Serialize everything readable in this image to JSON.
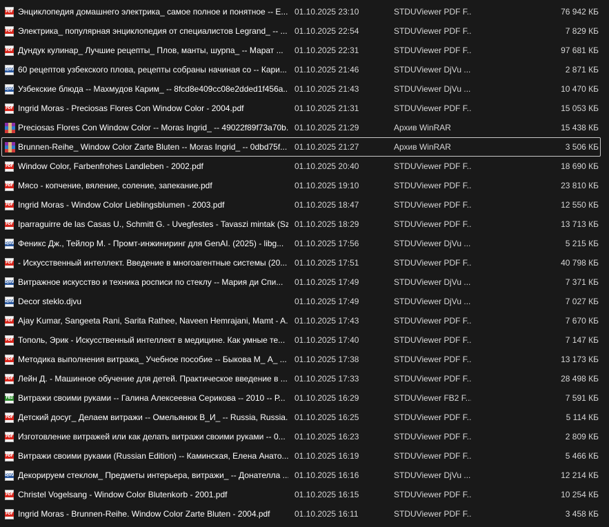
{
  "files": [
    {
      "name": "Энциклопедия домашнего электрика_ самое полное и понятное -- Е...",
      "date": "01.10.2025 23:10",
      "type": "STDUViewer PDF F...",
      "size": "76 942 КБ",
      "icon": "pdf-file-icon",
      "icon_label": "PDF"
    },
    {
      "name": "Электрика_ популярная энциклопедия от специалистов Legrand_ -- ...",
      "date": "01.10.2025 22:54",
      "type": "STDUViewer PDF F...",
      "size": "7 829 КБ",
      "icon": "pdf-file-icon",
      "icon_label": "PDF"
    },
    {
      "name": "Дундук кулинар_ Лучшие рецепты_ Плов, манты, шурпа_ -- Марат ...",
      "date": "01.10.2025 22:31",
      "type": "STDUViewer PDF F...",
      "size": "97 681 КБ",
      "icon": "pdf-file-icon",
      "icon_label": "PDF"
    },
    {
      "name": "60 рецептов узбекского плова, рецепты собраны начиная со -- Кари...",
      "date": "01.10.2025 21:46",
      "type": "STDUViewer DjVu ...",
      "size": "2 871 КБ",
      "icon": "djvu-file-icon",
      "icon_label": "DJVU"
    },
    {
      "name": "Узбекские блюда -- Махмудов Карим_ -- 8fcd8e409cc08e2dded1f456a...",
      "date": "01.10.2025 21:43",
      "type": "STDUViewer DjVu ...",
      "size": "10 470 КБ",
      "icon": "djvu-file-icon",
      "icon_label": "DJVU"
    },
    {
      "name": "Ingrid Moras - Preciosas Flores Con Window Color - 2004.pdf",
      "date": "01.10.2025 21:31",
      "type": "STDUViewer PDF F...",
      "size": "15 053 КБ",
      "icon": "pdf-file-icon",
      "icon_label": "PDF"
    },
    {
      "name": "Preciosas Flores Con Window Color -- Moras Ingrid_ -- 49022f89f73a70b...",
      "date": "01.10.2025 21:29",
      "type": "Архив WinRAR",
      "size": "15 438 КБ",
      "icon": "rar-archive-icon",
      "icon_label": ""
    },
    {
      "name": "Brunnen-Reihe_ Window Color Zarte Bluten -- Moras Ingrid_ -- 0dbd75f...",
      "date": "01.10.2025 21:27",
      "type": "Архив WinRAR",
      "size": "3 506 КБ",
      "icon": "rar-archive-icon",
      "icon_label": "",
      "selected": true
    },
    {
      "name": "Window Color, Farbenfrohes Landleben - 2002.pdf",
      "date": "01.10.2025 20:40",
      "type": "STDUViewer PDF F...",
      "size": "18 690 КБ",
      "icon": "pdf-file-icon",
      "icon_label": "PDF"
    },
    {
      "name": "Мясо - копчение, вяление, соление, запекание.pdf",
      "date": "01.10.2025 19:10",
      "type": "STDUViewer PDF F...",
      "size": "23 810 КБ",
      "icon": "pdf-file-icon",
      "icon_label": "PDF"
    },
    {
      "name": "Ingrid Moras - Window Color Lieblingsblumen - 2003.pdf",
      "date": "01.10.2025 18:47",
      "type": "STDUViewer PDF F...",
      "size": "12 550 КБ",
      "icon": "pdf-file-icon",
      "icon_label": "PDF"
    },
    {
      "name": "Iparraguirre de las Casas U., Schmitt G. - Uvegfestes - Tavaszi mintak (Szi...",
      "date": "01.10.2025 18:29",
      "type": "STDUViewer PDF F...",
      "size": "13 713 КБ",
      "icon": "pdf-file-icon",
      "icon_label": "PDF"
    },
    {
      "name": "Феникс Дж., Тейлор М. - Промт-инжиниринг для GenAI. (2025) - libg...",
      "date": "01.10.2025 17:56",
      "type": "STDUViewer DjVu ...",
      "size": "5 215 КБ",
      "icon": "djvu-file-icon",
      "icon_label": "DJVU"
    },
    {
      "name": "- Искусственный интеллект. Введение в многоагентные системы (20...",
      "date": "01.10.2025 17:51",
      "type": "STDUViewer PDF F...",
      "size": "40 798 КБ",
      "icon": "pdf-file-icon",
      "icon_label": "PDF"
    },
    {
      "name": "Витражное искусство и техника росписи по стеклу -- Мария ди Спи...",
      "date": "01.10.2025 17:49",
      "type": "STDUViewer DjVu ...",
      "size": "7 371 КБ",
      "icon": "djvu-file-icon",
      "icon_label": "DJVU"
    },
    {
      "name": "Decor steklo.djvu",
      "date": "01.10.2025 17:49",
      "type": "STDUViewer DjVu ...",
      "size": "7 027 КБ",
      "icon": "djvu-file-icon",
      "icon_label": "DJVU"
    },
    {
      "name": "Ajay Kumar, Sangeeta Rani, Sarita Rathee, Naveen Hemrajani, Mamt - A...",
      "date": "01.10.2025 17:43",
      "type": "STDUViewer PDF F...",
      "size": "7 670 КБ",
      "icon": "pdf-file-icon",
      "icon_label": "PDF"
    },
    {
      "name": "Тополь, Эрик - Искусственный интеллект в медицине. Как умные те...",
      "date": "01.10.2025 17:40",
      "type": "STDUViewer PDF F...",
      "size": "7 147 КБ",
      "icon": "pdf-file-icon",
      "icon_label": "PDF"
    },
    {
      "name": "Методика выполнения витража_ Учебное пособие -- Быкова М_ А_ ...",
      "date": "01.10.2025 17:38",
      "type": "STDUViewer PDF F...",
      "size": "13 173 КБ",
      "icon": "pdf-file-icon",
      "icon_label": "PDF"
    },
    {
      "name": "Лейн Д. - Машинное обучение для детей. Практическое введение в ...",
      "date": "01.10.2025 17:33",
      "type": "STDUViewer PDF F...",
      "size": "28 498 КБ",
      "icon": "pdf-file-icon",
      "icon_label": "PDF"
    },
    {
      "name": "Витражи своими руками -- Галина Алексеевна Серикова -- 2010 -- Р...",
      "date": "01.10.2025 16:29",
      "type": "STDUViewer FB2 F...",
      "size": "7 591 КБ",
      "icon": "fb2-file-icon",
      "icon_label": "FB2"
    },
    {
      "name": "Детский досуг_ Делаем витражи -- Омельянюк В_И_ -- Russia, Russia...",
      "date": "01.10.2025 16:25",
      "type": "STDUViewer PDF F...",
      "size": "5 114 КБ",
      "icon": "pdf-file-icon",
      "icon_label": "PDF"
    },
    {
      "name": "Изготовление витражей или как делать витражи своими руками -- 0...",
      "date": "01.10.2025 16:23",
      "type": "STDUViewer PDF F...",
      "size": "2 809 КБ",
      "icon": "pdf-file-icon",
      "icon_label": "PDF"
    },
    {
      "name": "Витражи своими руками (Russian Edition) -- Каминская, Елена Анато...",
      "date": "01.10.2025 16:19",
      "type": "STDUViewer PDF F...",
      "size": "5 466 КБ",
      "icon": "pdf-file-icon",
      "icon_label": "PDF"
    },
    {
      "name": "Декорируем стеклом_ Предметы интерьера, витражи_ -- Донателла ...",
      "date": "01.10.2025 16:16",
      "type": "STDUViewer DjVu ...",
      "size": "12 214 КБ",
      "icon": "djvu-file-icon",
      "icon_label": "DJVU"
    },
    {
      "name": "Christel Vogelsang - Window Color Blutenkorb - 2001.pdf",
      "date": "01.10.2025 16:15",
      "type": "STDUViewer PDF F...",
      "size": "10 254 КБ",
      "icon": "pdf-file-icon",
      "icon_label": "PDF"
    },
    {
      "name": "Ingrid Moras - Brunnen-Reihe. Window Color Zarte Bluten - 2004.pdf",
      "date": "01.10.2025 16:11",
      "type": "STDUViewer PDF F...",
      "size": "3 458 КБ",
      "icon": "pdf-file-icon",
      "icon_label": "PDF"
    }
  ]
}
